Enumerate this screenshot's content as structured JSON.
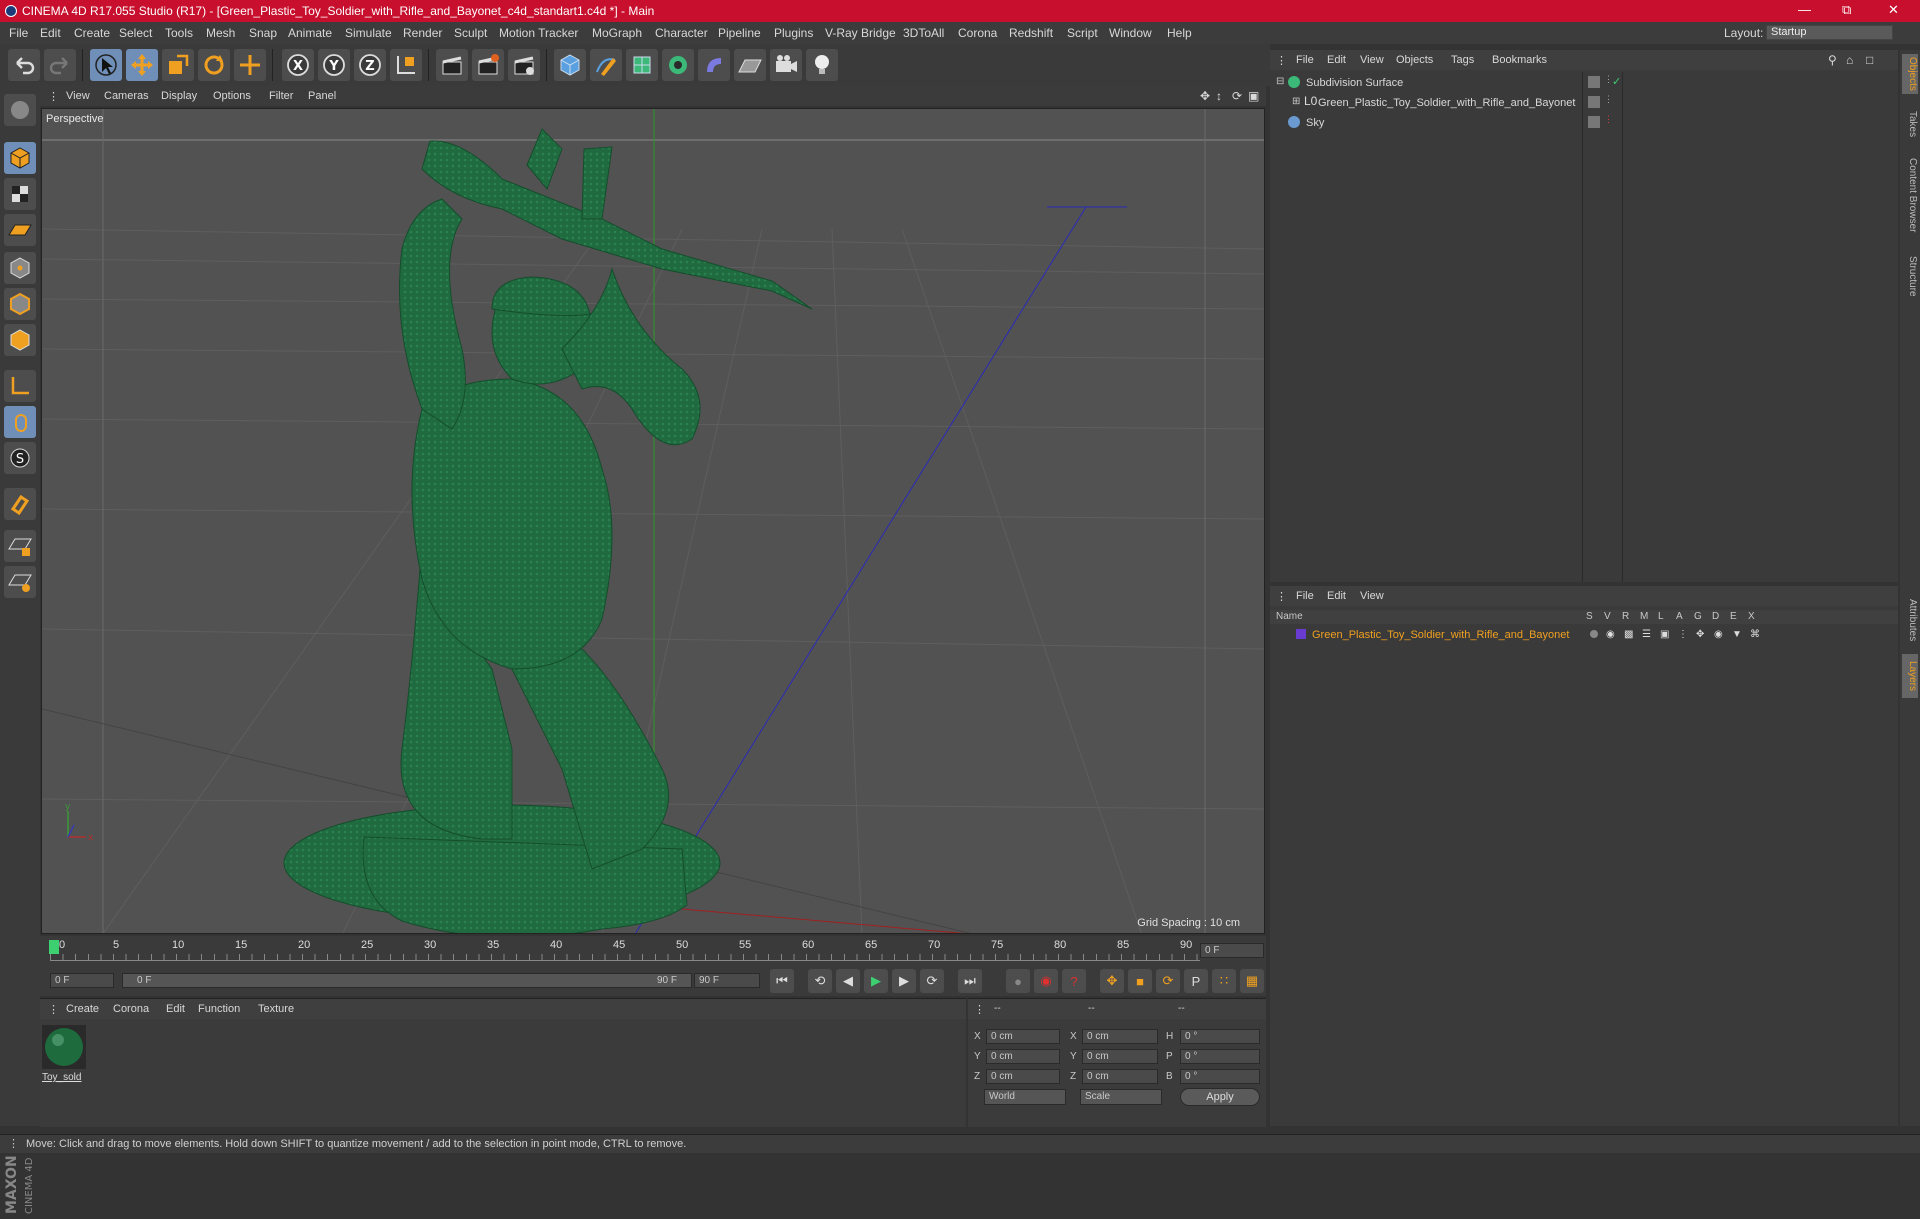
{
  "app": {
    "title": "CINEMA 4D R17.055 Studio (R17) - [Green_Plastic_Toy_Soldier_with_Rifle_and_Bayonet_c4d_standart1.c4d *] - Main"
  },
  "menu": [
    "File",
    "Edit",
    "Create",
    "Select",
    "Tools",
    "Mesh",
    "Snap",
    "Animate",
    "Simulate",
    "Render",
    "Sculpt",
    "Motion Tracker",
    "MoGraph",
    "Character",
    "Pipeline",
    "Plugins",
    "V-Ray Bridge",
    "3DToAll",
    "Corona",
    "Redshift",
    "Script",
    "Window",
    "Help"
  ],
  "layout": {
    "label": "Layout:",
    "value": "Startup"
  },
  "viewport": {
    "menu": [
      "View",
      "Cameras",
      "Display",
      "Options",
      "Filter",
      "Panel"
    ],
    "label": "Perspective",
    "grid_spacing": "Grid Spacing : 10 cm"
  },
  "timeline": {
    "ticks": [
      "0",
      "5",
      "10",
      "15",
      "20",
      "25",
      "30",
      "35",
      "40",
      "45",
      "50",
      "55",
      "60",
      "65",
      "70",
      "75",
      "80",
      "85",
      "90"
    ],
    "current_frame": "0 F"
  },
  "playback": {
    "start": "0 F",
    "slider_start": "0 F",
    "slider_end": "90 F",
    "end": "90 F"
  },
  "materials": {
    "menu": [
      "Create",
      "Corona",
      "Edit",
      "Function",
      "Texture"
    ],
    "items": [
      {
        "name": "Toy_sold"
      }
    ]
  },
  "coords": {
    "header": [
      "--",
      "--",
      "--"
    ],
    "rows": [
      {
        "a": "X",
        "av": "0 cm",
        "b": "X",
        "bv": "0 cm",
        "c": "H",
        "cv": "0 °"
      },
      {
        "a": "Y",
        "av": "0 cm",
        "b": "Y",
        "bv": "0 cm",
        "c": "P",
        "cv": "0 °"
      },
      {
        "a": "Z",
        "av": "0 cm",
        "b": "Z",
        "bv": "0 cm",
        "c": "B",
        "cv": "0 °"
      }
    ],
    "world": "World",
    "scale": "Scale",
    "apply": "Apply"
  },
  "objects": {
    "menu": [
      "File",
      "Edit",
      "View",
      "Objects",
      "Tags",
      "Bookmarks"
    ],
    "items": [
      {
        "name": "Subdivision Surface"
      },
      {
        "name": "Green_Plastic_Toy_Soldier_with_Rifle_and_Bayonet"
      },
      {
        "name": "Sky"
      }
    ]
  },
  "layers": {
    "menu": [
      "File",
      "Edit",
      "View"
    ],
    "columns": [
      "Name",
      "S",
      "V",
      "R",
      "M",
      "L",
      "A",
      "G",
      "D",
      "E",
      "X"
    ],
    "items": [
      {
        "name": "Green_Plastic_Toy_Soldier_with_Rifle_and_Bayonet",
        "color": "#6a3bd0"
      }
    ]
  },
  "sidetabs": [
    "Objects",
    "Takes",
    "Content Browser",
    "Structure",
    "Attributes",
    "Layers"
  ],
  "status": "Move: Click and drag to move elements. Hold down SHIFT to quantize movement / add to the selection in point mode, CTRL to remove.",
  "brand": {
    "maxon": "MAXON",
    "c4d": "CINEMA 4D"
  },
  "colors": {
    "title_bar": "#c8102e",
    "soldier": "#1e6b3e",
    "accent": "#e6a020"
  }
}
